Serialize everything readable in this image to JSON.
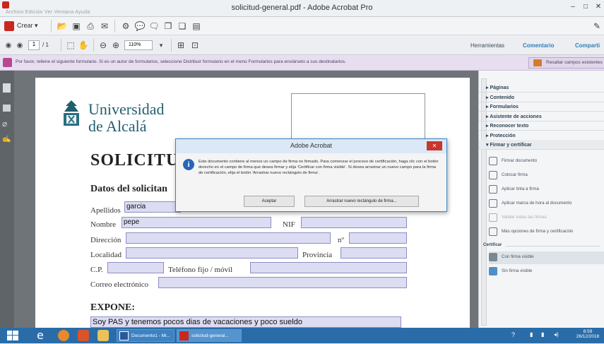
{
  "window": {
    "title": "solicitud-general.pdf - Adobe Acrobat Pro",
    "menu": "Archivo   Edición   Ver   Ventana   Ayuda",
    "minimize": "–",
    "maximize": "□",
    "close": "✕"
  },
  "toolbar": {
    "create_label": "Crear",
    "page_current": "1",
    "page_total": "/ 1",
    "zoom": "110%"
  },
  "tabs": {
    "tools": "Herramientas",
    "comment": "Comentario",
    "share": "Comparti"
  },
  "notice": {
    "text": "Por favor, rellene el siguiente formulario. Si es un autor de formularios, seleccione Distribuir formulario en el menú Formularios para enviárselo a sus destinatarios.",
    "highlight_button": "Resaltar campos existentes"
  },
  "document": {
    "university_line1": "Universidad",
    "university_line2": "de Alcalá",
    "heading": "SOLICITU",
    "section_applicant": "Datos del solicitan",
    "labels": {
      "apellidos": "Apellidos",
      "nombre": "Nombre",
      "nif": "NIF",
      "direccion": "Dirección",
      "numero": "nº",
      "localidad": "Localidad",
      "provincia": "Provincia",
      "cp": "C.P.",
      "telefono": "Teléfono fijo / móvil",
      "correo": "Correo electrónico"
    },
    "values": {
      "apellidos": "garcia",
      "nombre": "pepe"
    },
    "section_expone": "EXPONE:",
    "expone_text": "Soy PAS y tenemos pocos dias de vacaciones y poco sueldo"
  },
  "dialog": {
    "title": "Adobe Acrobat",
    "message": "Este documento contiene al menos un campo de firma no firmado. Para comenzar el proceso de certificación, haga clic con el botón derecho en el campo de firma que desea firmar y elija 'Certificar con firma visible'. Si desea arrastrar un nuevo campo para la firma de certificación, elija el botón 'Arrastrar nuevo rectángulo de firma'.",
    "accept": "Aceptar",
    "drag_new": "Arrastrar nuevo rectángulo de firma..."
  },
  "rightpane": {
    "sections": [
      "Páginas",
      "Contenido",
      "Formularios",
      "Asistente de acciones",
      "Reconocer texto",
      "Protección"
    ],
    "active_section": "Firmar y certificar",
    "items": [
      "Firmar documento",
      "Colocar firma",
      "Aplicar tinta a firma",
      "Aplicar marca de hora al documento",
      "Validar todas las firmas",
      "Más opciones de firma y certificación"
    ],
    "certify_header": "Certificar",
    "certify_items": [
      "Con firma visible",
      "Sin firma visible"
    ]
  },
  "taskbar": {
    "word_label": "Documento1 - Mi...",
    "acrobat_label": "solicitud-general...",
    "time": "8:59",
    "date": "26/12/2018"
  }
}
